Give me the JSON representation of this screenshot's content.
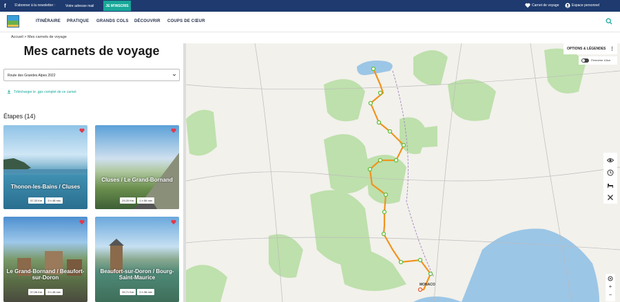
{
  "topbar": {
    "newsletter_text": "S'abonner à la newsletter :",
    "email_placeholder": "Votre adresse mail",
    "subscribe_label": "JE M'INSCRIS",
    "travel_books": "Carnet de voyage",
    "personal_space": "Espace personnel"
  },
  "nav": {
    "items": [
      "ITINÉRAIRE",
      "PRATIQUE",
      "GRANDS COLS",
      "DÉCOUVRIR",
      "COUPS DE CŒUR"
    ]
  },
  "breadcrumb": "Accueil > Mes carnets de voyage",
  "left": {
    "title": "Mes carnets de voyage",
    "selected_book": "Route des Grandes Alpes 2022",
    "download_label": "Télécharger le .gpx complet de ce carnet",
    "stages_label": "Étapes (14)",
    "cards": [
      {
        "title": "Thonon-les-Bains / Cluses",
        "distance": "57,33 Km",
        "duration": "3 h 48 min"
      },
      {
        "title": "Cluses / Le Grand-Bornand",
        "distance": "29,20 Km",
        "duration": "1 h 56 min"
      },
      {
        "title": "Le Grand-Bornand / Beaufort-sur-Doron",
        "distance": "57,06 Km",
        "duration": "3 h 48 min"
      },
      {
        "title": "Beaufort-sur-Doron / Bourg-Saint-Maurice",
        "distance": "39,71 Km",
        "duration": "2 h 38 min"
      }
    ]
  },
  "map": {
    "options_label": "OPTIONS & LÉGENDES",
    "perimeter_label": "Périmètre 10km",
    "end_city": "MONACO",
    "zoom_in": "+",
    "zoom_out": "−",
    "route_color": "#f0931e",
    "stop_color": "#5fbf3a"
  },
  "icons": [
    "facebook-icon",
    "heart-icon",
    "user-icon",
    "search-icon",
    "chevron-down-icon",
    "download-icon",
    "eye-icon",
    "clock-icon",
    "bed-icon",
    "tools-icon",
    "locate-icon"
  ]
}
